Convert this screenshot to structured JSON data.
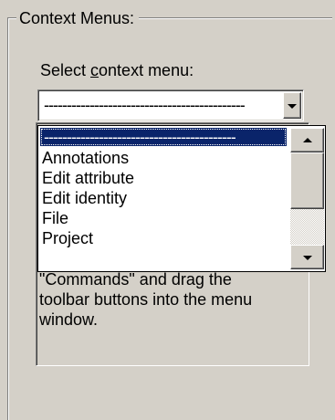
{
  "group": {
    "legend": "Context Menus:"
  },
  "select_label": {
    "before": "Select ",
    "accelerator": "c",
    "after": "ontext menu:"
  },
  "combo": {
    "value": "--------------------------------------------"
  },
  "dropdown": {
    "items": [
      {
        "label": "------------------------------------------",
        "selected": true
      },
      {
        "label": "Annotations",
        "selected": false
      },
      {
        "label": "Edit attribute",
        "selected": false
      },
      {
        "label": "Edit identity",
        "selected": false
      },
      {
        "label": "File",
        "selected": false
      },
      {
        "label": "Project",
        "selected": false
      }
    ],
    "scroll_position": 0.0
  },
  "description": {
    "text": "change the page to\n\"Commands\" and drag the\ntoolbar buttons into the menu\nwindow."
  },
  "colors": {
    "window_face": "#d4d0c8",
    "selection": "#0a246a",
    "field_background": "#ffffff"
  },
  "icons": {
    "combo_arrow": "chevron-down-icon",
    "scroll_up": "arrow-up-icon",
    "scroll_down": "arrow-down-icon"
  }
}
